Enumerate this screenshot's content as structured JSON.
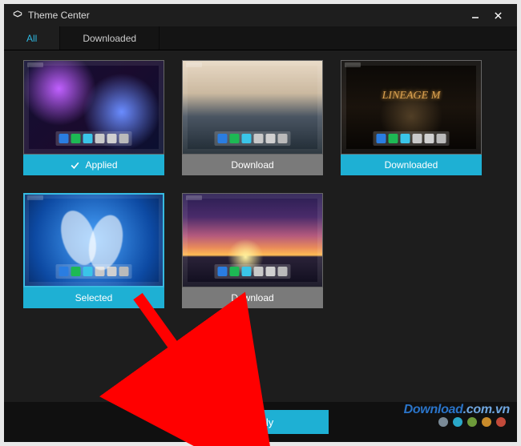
{
  "window": {
    "title": "Theme Center"
  },
  "tabs": {
    "all": "All",
    "downloaded": "Downloaded",
    "active_index": 0
  },
  "themes": [
    {
      "id": "galaxy",
      "status": "applied",
      "status_label": "Applied",
      "label_style": "cyan",
      "bg": "bg-galaxy",
      "show_check": true,
      "logo": ""
    },
    {
      "id": "mountain",
      "status": "download",
      "status_label": "Download",
      "label_style": "gray",
      "bg": "bg-mountain",
      "show_check": false,
      "logo": ""
    },
    {
      "id": "lineage",
      "status": "downloaded",
      "status_label": "Downloaded",
      "label_style": "cyan",
      "bg": "bg-lineage",
      "show_check": false,
      "logo": "LINEAGE M"
    },
    {
      "id": "feather",
      "status": "selected",
      "status_label": "Selected",
      "label_style": "cyan",
      "bg": "bg-feather",
      "show_check": false,
      "logo": ""
    },
    {
      "id": "sunset",
      "status": "download",
      "status_label": "Download",
      "label_style": "gray",
      "bg": "bg-sunset",
      "show_check": false,
      "logo": ""
    }
  ],
  "actions": {
    "apply": "Apply"
  },
  "palette": {
    "accent": "#1eb0d4",
    "dots": [
      "#7a8a97",
      "#2aa8c9",
      "#6d9a3a",
      "#c98b2a",
      "#c24a3a"
    ]
  },
  "watermark": {
    "text_main": "Download",
    "text_suffix": ".com.vn"
  },
  "annotation": {
    "arrow_from_theme_index": 3,
    "arrow_to": "apply-button"
  }
}
